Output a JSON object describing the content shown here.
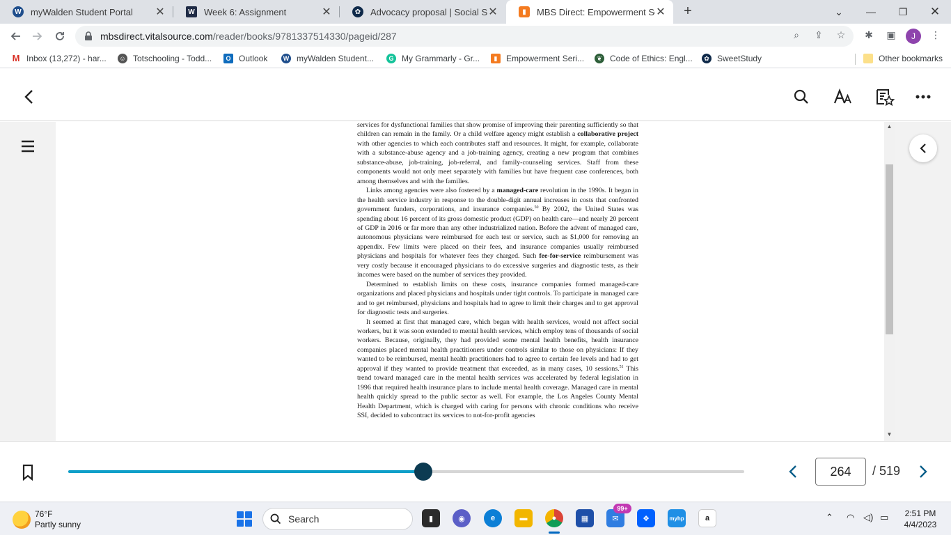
{
  "browser": {
    "tabs": [
      {
        "title": "myWalden Student Portal",
        "icon": "walden-icon",
        "color": "#1f4e8c"
      },
      {
        "title": "Week 6: Assignment",
        "icon": "walden-w-icon",
        "color": "#1f2b45"
      },
      {
        "title": "Advocacy proposal | Social Scien",
        "icon": "sweetstudy-icon",
        "color": "#0f2a4a"
      },
      {
        "title": "MBS Direct: Empowerment Series",
        "icon": "mbs-icon",
        "color": "#f47b20",
        "active": true
      }
    ],
    "new_tab": "+",
    "address": {
      "host": "mbsdirect.vitalsource.com",
      "path": "/reader/books/9781337514330/pageid/287"
    },
    "profile_initial": "J",
    "bookmarks": [
      {
        "label": "Inbox (13,272) - har...",
        "icon": "gmail-icon",
        "color": "#d93025"
      },
      {
        "label": "Totschooling - Todd...",
        "icon": "totschooling-icon",
        "color": "#555555"
      },
      {
        "label": "Outlook",
        "icon": "outlook-icon",
        "color": "#0f6cbd"
      },
      {
        "label": "myWalden Student...",
        "icon": "walden-icon",
        "color": "#1f4e8c"
      },
      {
        "label": "My Grammarly - Gr...",
        "icon": "grammarly-icon",
        "color": "#15c39a"
      },
      {
        "label": "Empowerment Seri...",
        "icon": "mbs-icon",
        "color": "#f47b20"
      },
      {
        "label": "Code of Ethics: Engl...",
        "icon": "nasw-icon",
        "color": "#2e5f3a"
      },
      {
        "label": "SweetStudy",
        "icon": "sweetstudy-icon",
        "color": "#0f2a4a"
      }
    ],
    "other_bookmarks": "Other bookmarks"
  },
  "reader": {
    "paragraphs": [
      {
        "cont": true,
        "html": "services for dysfunctional families that show promise of improving their parenting suffi­ciently so that children can remain in the family. Or a child welfare agency might establish a <b>collaborative project</b> with other agencies to which each contributes staff and resources. It might, for example, collaborate with a substance-abuse agency and a job-training agency, creating a new program that combines substance-abuse, job-training, job-referral, and family-counseling services. Staff from these components would not only meet separately with families but have frequent case conferences, both among themselves and with the families."
      },
      {
        "cont": false,
        "html": "Links among agencies were also fostered by a <b>managed-care</b> revolution in the 1990s. It began in the health service industry in response to the double-digit annual increases in costs that confronted government funders, corporations, and insurance companies.<sup>50</sup> By 2002, the United States was spending about 16 percent of its gross domestic product (GDP) on health care—and nearly 20 percent of GDP in 2016 or far more than any other industri­alized nation. Before the advent of managed care, autonomous physicians were reimbursed for each test or service, such as $1,000 for removing an appendix. Few limits were placed on their fees, and insurance companies usually reimbursed physicians and hospitals for whatever fees they charged. Such <b>fee-for-service</b> reimbursement was very costly because it encouraged physicians to do excessive surgeries and diagnostic tests, as their incomes were based on the number of services they provided."
      },
      {
        "cont": false,
        "html": "Determined to establish limits on these costs, insurance companies formed managed-care organizations and placed physicians and hospitals under tight controls. To participate in managed care and to get reimbursed, physicians and hospitals had to agree to limit their charges and to get approval for diagnostic tests and surgeries."
      },
      {
        "cont": false,
        "html": "It seemed at first that managed care, which began with health services, would not affect social workers, but it was soon extended to mental health services, which employ tens of thousands of social workers. Because, originally, they had provided some men­tal health benefits, health insurance companies placed mental health practitioners under controls similar to those on physicians: If they wanted to be reimbursed, mental health practitioners had to agree to certain fee levels and had to get approval if they wanted to provide treatment that exceeded, as in many cases, 10 sessions.<sup>51</sup> This trend toward managed care in the mental health services was accelerated by federal legislation in 1996 that required health insurance plans to include mental health coverage. Managed care in mental health quickly spread to the public sector as well. For example, the Los Angeles County Mental Health Department, which is charged with caring for persons with chronic conditions who receive SSI, decided to subcontract its services to not-for-profit agencies"
      }
    ],
    "progress_fraction": 0.525,
    "current_page": "264",
    "total_pages": "/ 519"
  },
  "taskbar": {
    "temperature": "76°F",
    "weather": "Partly sunny",
    "search_placeholder": "Search",
    "mail_badge": "99+",
    "time": "2:51 PM",
    "date": "4/4/2023"
  }
}
